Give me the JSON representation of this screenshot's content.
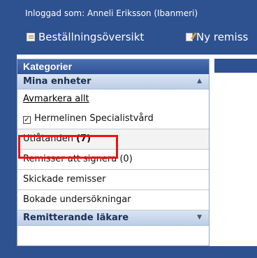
{
  "header": {
    "login_text": "Inloggad som: Anneli Eriksson (Ibanmeri)",
    "nav": [
      {
        "label": "Beställningsöversikt",
        "icon": "document-list-icon"
      },
      {
        "label": "Ny remiss",
        "icon": "new-referral-icon"
      }
    ]
  },
  "sidebar": {
    "title": "Kategorier",
    "sections": [
      {
        "label": "Mina enheter",
        "expanded": true
      },
      {
        "label": "Remitterande läkare",
        "expanded": false
      }
    ],
    "deselect_all": "Avmarkera allt",
    "unit_checkbox": {
      "label": "Hermelinen Specialistvård",
      "checked": true
    },
    "items": [
      {
        "label": "Utlåtanden",
        "count": "(7)",
        "highlighted": true
      },
      {
        "label": "Remisser att signera (0)"
      },
      {
        "label": "Skickade remisser"
      },
      {
        "label": "Bokade undersökningar"
      }
    ]
  },
  "colors": {
    "header_bg": "#2e5190",
    "highlight": "#ee1111"
  }
}
